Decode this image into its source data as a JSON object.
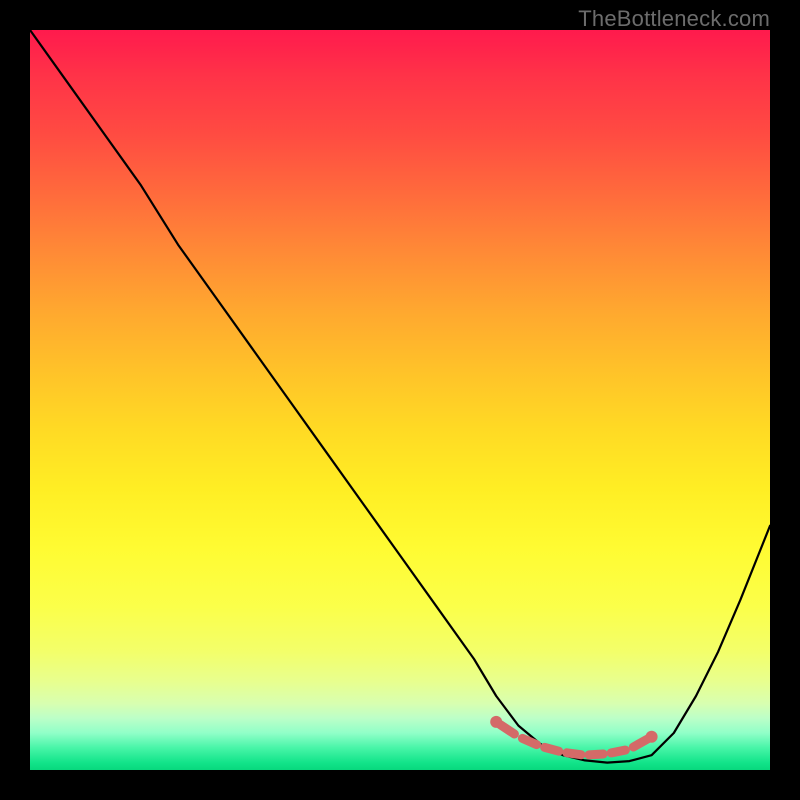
{
  "watermark": "TheBottleneck.com",
  "colors": {
    "frame": "#000000",
    "curve": "#000000",
    "marker": "#d46a68"
  },
  "chart_data": {
    "type": "line",
    "title": "",
    "xlabel": "",
    "ylabel": "",
    "xlim": [
      0,
      100
    ],
    "ylim": [
      0,
      100
    ],
    "series": [
      {
        "name": "bottleneck-curve",
        "x": [
          0,
          5,
          10,
          15,
          20,
          25,
          30,
          35,
          40,
          45,
          50,
          55,
          60,
          63,
          66,
          69,
          72,
          75,
          78,
          81,
          84,
          87,
          90,
          93,
          96,
          100
        ],
        "y": [
          100,
          93,
          86,
          79,
          71,
          64,
          57,
          50,
          43,
          36,
          29,
          22,
          15,
          10,
          6,
          3.5,
          2,
          1.3,
          1,
          1.2,
          2,
          5,
          10,
          16,
          23,
          33
        ]
      }
    ],
    "markers": {
      "name": "optimal-range",
      "x": [
        63,
        66,
        69,
        72,
        75,
        78,
        81,
        84
      ],
      "y": [
        6.5,
        4.5,
        3.2,
        2.4,
        2,
        2.2,
        2.8,
        4.5
      ]
    }
  }
}
